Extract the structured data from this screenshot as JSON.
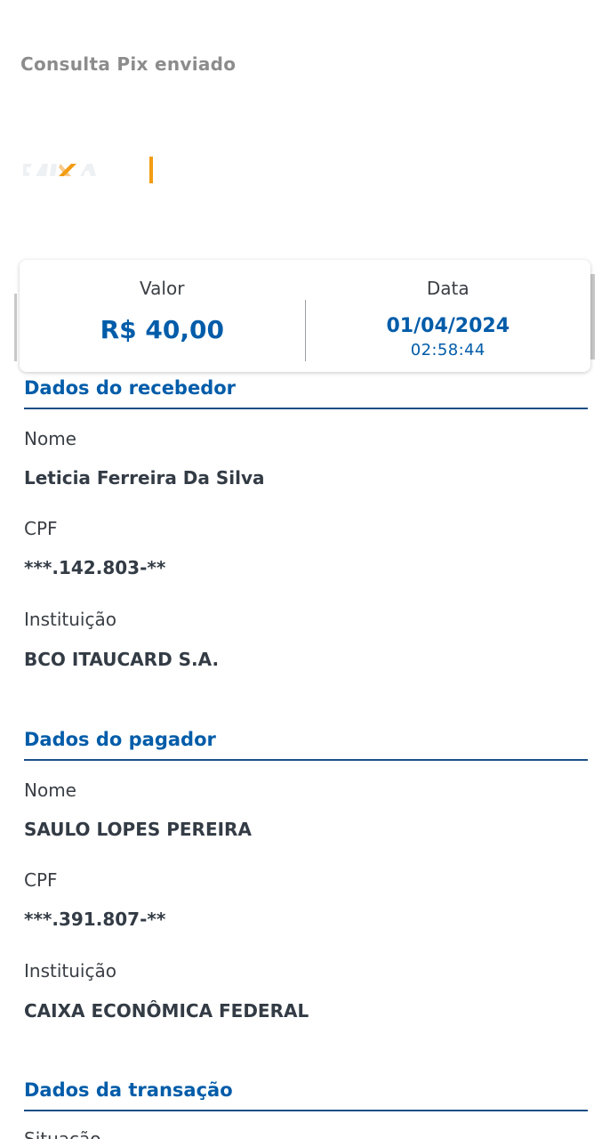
{
  "screen_title": "Consulta Pix enviado",
  "logo": {
    "name": "caixa-logo",
    "divider_color": "#f39c12"
  },
  "summary": {
    "value_label": "Valor",
    "value_amount": "R$ 40,00",
    "date_label": "Data",
    "date": "01/04/2024",
    "time": "02:58:44"
  },
  "receiver": {
    "title": "Dados do recebedor",
    "name_label": "Nome",
    "name": "Leticia Ferreira Da Silva",
    "cpf_label": "CPF",
    "cpf": "***.142.803-**",
    "institution_label": "Instituição",
    "institution": "BCO ITAUCARD S.A."
  },
  "payer": {
    "title": "Dados do pagador",
    "name_label": "Nome",
    "name": "SAULO LOPES PEREIRA",
    "cpf_label": "CPF",
    "cpf": "***.391.807-**",
    "institution_label": "Instituição",
    "institution": "CAIXA ECONÔMICA FEDERAL"
  },
  "transaction": {
    "title": "Dados da transação",
    "status_label": "Situação"
  },
  "colors": {
    "accent": "#005ca9",
    "heading_rule": "#1b4f86",
    "title_gray": "#8c8c8c"
  }
}
